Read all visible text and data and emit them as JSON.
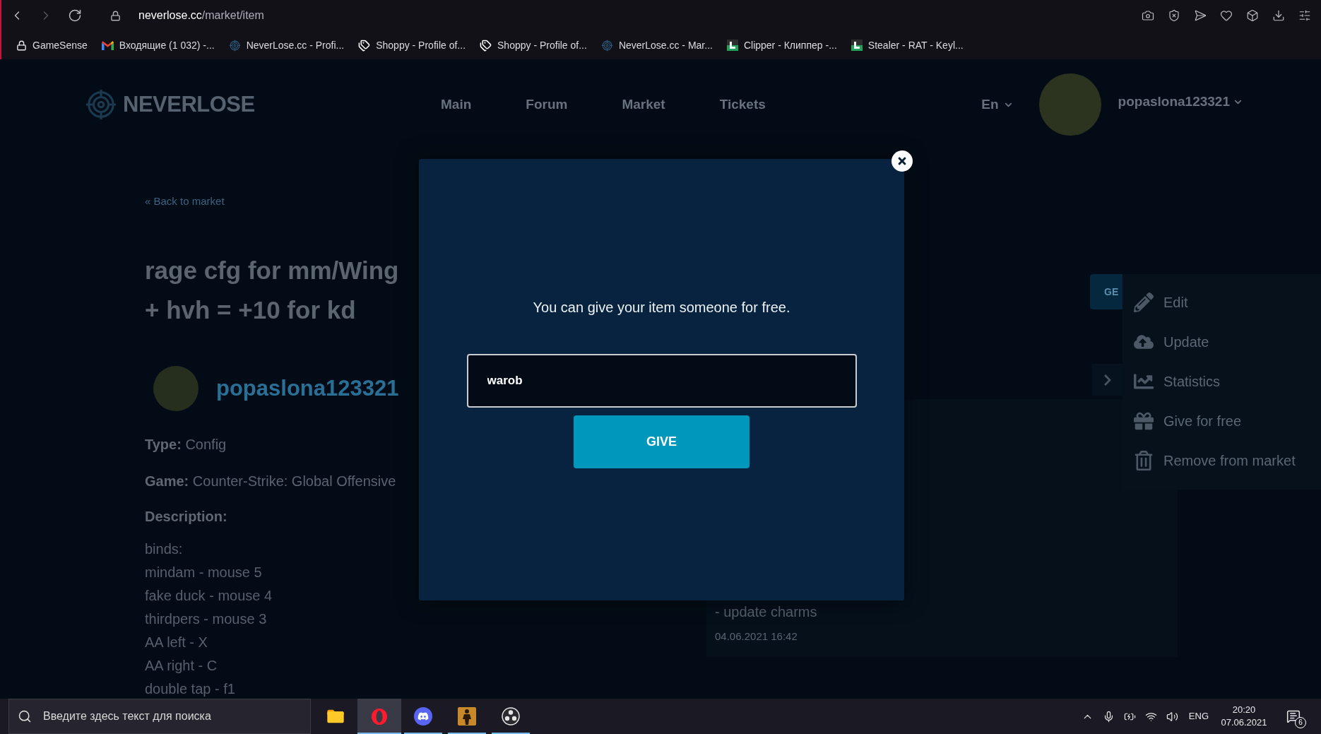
{
  "browser": {
    "nav_buttons": [
      {
        "kind": "back",
        "disabled": false
      },
      {
        "kind": "forward",
        "disabled": true
      },
      {
        "kind": "reload",
        "disabled": false
      }
    ],
    "address": {
      "host": "neverlose.cc",
      "path": "/market/item"
    },
    "toolbar_buttons": [
      {
        "kind": "camera"
      },
      {
        "kind": "shield"
      },
      {
        "kind": "send"
      },
      {
        "kind": "heart"
      },
      {
        "kind": "cube"
      },
      {
        "kind": "download"
      },
      {
        "kind": "settings"
      }
    ],
    "bookmarks": [
      {
        "kind": "lock",
        "label": "GameSense"
      },
      {
        "kind": "mail",
        "label": "Входящие (1 032) -..."
      },
      {
        "kind": "target",
        "label": "NeverLose.cc - Profi..."
      },
      {
        "kind": "tag",
        "label": "Shoppy - Profile of..."
      },
      {
        "kind": "tag",
        "label": "Shoppy - Profile of..."
      },
      {
        "kind": "target",
        "label": "NeverLose.cc - Mar..."
      },
      {
        "kind": "square",
        "label": "Clipper - Клиппер -..."
      },
      {
        "kind": "square",
        "label": "Stealer - RAT - Keyl..."
      }
    ]
  },
  "page": {
    "logo": "NEVERLOSE",
    "nav": [
      "Main",
      "Forum",
      "Market",
      "Tickets"
    ],
    "language": "En",
    "username": "popaslona123321",
    "back_link": "« Back to market",
    "title_lines": [
      "rage cfg for mm/Wing",
      "+ hvh = +10 for kd"
    ],
    "author": "popaslona123321",
    "details": [
      {
        "label": "Type:",
        "value": "Config"
      },
      {
        "label": "Game:",
        "value": "Counter-Strike: Global Offensive"
      }
    ],
    "description_label": "Description:",
    "description_lines": [
      "binds:",
      "mindam - mouse 5",
      "fake duck - mouse 4",
      "thirdpers - mouse 3",
      "AA left - X",
      "AA right - C",
      "double tap - f1"
    ],
    "action_button": "GE",
    "changelog": {
      "entry": "- update charms",
      "date": "04.06.2021 16:42"
    },
    "menu": [
      {
        "kind": "edit",
        "label": "Edit"
      },
      {
        "kind": "upload",
        "label": "Update"
      },
      {
        "kind": "statistics",
        "label": "Statistics"
      },
      {
        "kind": "gift",
        "label": "Give for free"
      },
      {
        "kind": "remove",
        "label": "Remove from market"
      }
    ]
  },
  "dialog": {
    "message": "You can give your item someone for free.",
    "input": {
      "value": "warob"
    },
    "button": "GIVE"
  },
  "taskbar": {
    "search": {
      "placeholder": "Введите здесь текст для поиска"
    },
    "apps": [
      {
        "kind": "folder",
        "selected": false,
        "running": false
      },
      {
        "kind": "ring",
        "selected": true,
        "running": true
      },
      {
        "kind": "chat",
        "selected": false,
        "running": true
      },
      {
        "kind": "figure",
        "selected": false,
        "running": true
      },
      {
        "kind": "obs",
        "selected": false,
        "running": true
      }
    ],
    "tray_icons": [
      {
        "kind": "chevron"
      },
      {
        "kind": "mic"
      },
      {
        "kind": "battery"
      },
      {
        "kind": "wifi"
      },
      {
        "kind": "speaker"
      }
    ],
    "language": "ENG",
    "time": "20:20",
    "date": "07.06.2021",
    "notification_count": "6"
  }
}
